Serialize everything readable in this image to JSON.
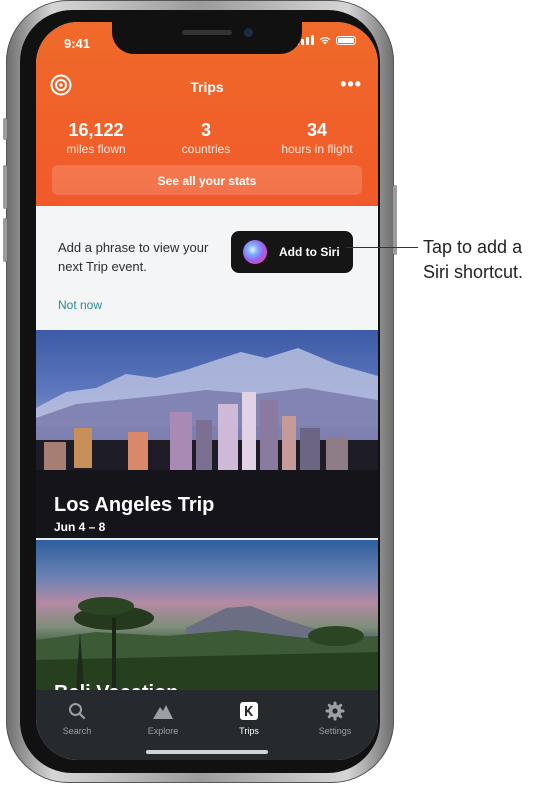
{
  "status": {
    "time": "9:41"
  },
  "header": {
    "title": "Trips",
    "more_label": "•••"
  },
  "stats": [
    {
      "value": "16,122",
      "label": "miles flown"
    },
    {
      "value": "3",
      "label": "countries"
    },
    {
      "value": "34",
      "label": "hours in flight"
    }
  ],
  "stats_button": "See all your stats",
  "siri_card": {
    "text": "Add a phrase to view your next Trip event.",
    "button_label": "Add to Siri",
    "dismiss_label": "Not now"
  },
  "trips": [
    {
      "title": "Los Angeles Trip",
      "dates": "Jun 4 – 8"
    },
    {
      "title": "Bali Vacation",
      "dates": ""
    }
  ],
  "tabs": [
    {
      "label": "Search",
      "icon": "search-icon"
    },
    {
      "label": "Explore",
      "icon": "mountain-icon"
    },
    {
      "label": "Trips",
      "icon": "k-logo-icon"
    },
    {
      "label": "Settings",
      "icon": "gear-icon"
    }
  ],
  "callout": {
    "line1": "Tap to add a",
    "line2": "Siri shortcut."
  },
  "colors": {
    "accent": "#f1592a",
    "tabbar": "#26292d",
    "link": "#2a8b94"
  }
}
